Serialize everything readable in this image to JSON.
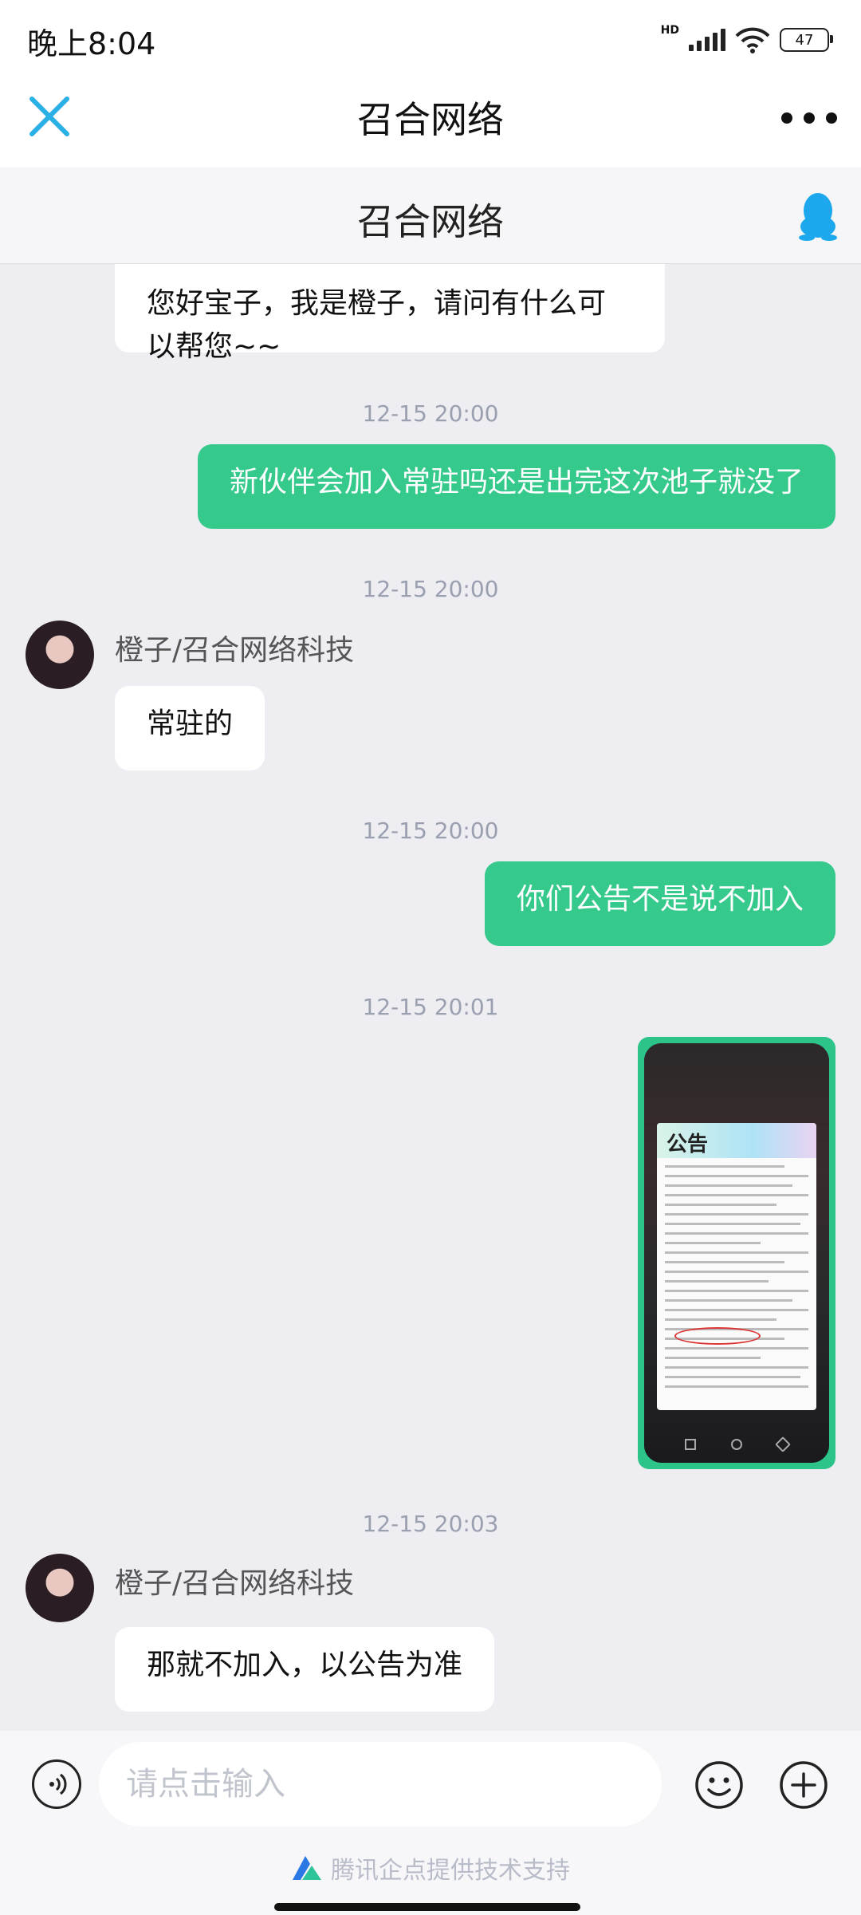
{
  "status_bar": {
    "time": "晚上8:04",
    "network": "HD",
    "battery": "47"
  },
  "header": {
    "title": "召合网络"
  },
  "subheader": {
    "title": "召合网络"
  },
  "messages": {
    "m0": {
      "text": "您好宝子，我是橙子，请问有什么可\n以帮您~~"
    },
    "ts1": "12-15 20:00",
    "m1": {
      "text": "新伙伴会加入常驻吗还是出完这次池子就没了"
    },
    "ts2": "12-15 20:00",
    "sender1": "橙子/召合网络科技",
    "m2": {
      "text": "常驻的"
    },
    "ts3": "12-15 20:00",
    "m3": {
      "text": "你们公告不是说不加入"
    },
    "ts4": "12-15 20:01",
    "image": {
      "title": "公告"
    },
    "ts5": "12-15 20:03",
    "sender2": "橙子/召合网络科技",
    "m4": {
      "text": "那就不加入，以公告为准"
    }
  },
  "input": {
    "placeholder": "请点击输入"
  },
  "footer": {
    "powered_by": "腾讯企点提供技术支持"
  },
  "colors": {
    "accent": "#36c98c",
    "close_icon": "#2bb0e6",
    "qq_icon": "#1da8ee"
  }
}
